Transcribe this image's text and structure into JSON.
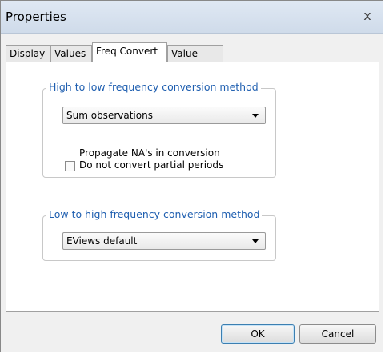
{
  "window": {
    "title": "Properties",
    "close_label": "x"
  },
  "tabs": [
    "Display",
    "Values",
    "Freq Convert",
    "Value Map"
  ],
  "high_to_low": {
    "legend": "High to low frequency conversion method",
    "method": "Sum observations",
    "propagate_na_label": "Propagate NA's in conversion",
    "no_partial_label": "Do not convert partial periods"
  },
  "low_to_high": {
    "legend": "Low to high frequency conversion method",
    "method": "EViews default"
  },
  "buttons": {
    "ok": "OK",
    "cancel": "Cancel"
  }
}
